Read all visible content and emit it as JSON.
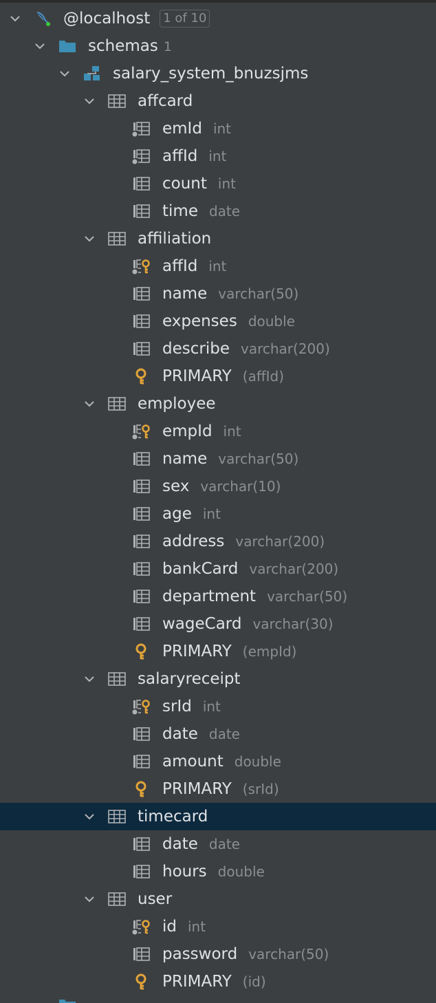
{
  "root": {
    "label": "@localhost",
    "badge": "1 of 10"
  },
  "schemas": {
    "label": "schemas",
    "count": "1"
  },
  "schema": {
    "label": "salary_system_bnuzsjms"
  },
  "tables": [
    {
      "name": "affcard",
      "columns": [
        {
          "name": "emId",
          "type": "int",
          "kind": "fk"
        },
        {
          "name": "affId",
          "type": "int",
          "kind": "fk"
        },
        {
          "name": "count",
          "type": "int",
          "kind": "col"
        },
        {
          "name": "time",
          "type": "date",
          "kind": "col"
        }
      ]
    },
    {
      "name": "affiliation",
      "columns": [
        {
          "name": "affId",
          "type": "int",
          "kind": "pk"
        },
        {
          "name": "name",
          "type": "varchar(50)",
          "kind": "col"
        },
        {
          "name": "expenses",
          "type": "double",
          "kind": "col"
        },
        {
          "name": "describe",
          "type": "varchar(200)",
          "kind": "col"
        },
        {
          "name": "PRIMARY",
          "type": "(affId)",
          "kind": "key"
        }
      ]
    },
    {
      "name": "employee",
      "columns": [
        {
          "name": "empId",
          "type": "int",
          "kind": "pk"
        },
        {
          "name": "name",
          "type": "varchar(50)",
          "kind": "col"
        },
        {
          "name": "sex",
          "type": "varchar(10)",
          "kind": "col"
        },
        {
          "name": "age",
          "type": "int",
          "kind": "col"
        },
        {
          "name": "address",
          "type": "varchar(200)",
          "kind": "col"
        },
        {
          "name": "bankCard",
          "type": "varchar(200)",
          "kind": "col"
        },
        {
          "name": "department",
          "type": "varchar(50)",
          "kind": "col"
        },
        {
          "name": "wageCard",
          "type": "varchar(30)",
          "kind": "col"
        },
        {
          "name": "PRIMARY",
          "type": "(empId)",
          "kind": "key"
        }
      ]
    },
    {
      "name": "salaryreceipt",
      "columns": [
        {
          "name": "srId",
          "type": "int",
          "kind": "pk"
        },
        {
          "name": "date",
          "type": "date",
          "kind": "col"
        },
        {
          "name": "amount",
          "type": "double",
          "kind": "col"
        },
        {
          "name": "PRIMARY",
          "type": "(srId)",
          "kind": "key"
        }
      ]
    },
    {
      "name": "timecard",
      "selected": true,
      "columns": [
        {
          "name": "date",
          "type": "date",
          "kind": "col"
        },
        {
          "name": "hours",
          "type": "double",
          "kind": "col"
        }
      ]
    },
    {
      "name": "user",
      "columns": [
        {
          "name": "id",
          "type": "int",
          "kind": "pk"
        },
        {
          "name": "password",
          "type": "varchar(50)",
          "kind": "col"
        },
        {
          "name": "PRIMARY",
          "type": "(id)",
          "kind": "key"
        }
      ]
    }
  ],
  "colors": {
    "background": "#3c3f41",
    "selection": "#0d293e",
    "text": "#dfe1e5",
    "muted": "#8c8e91",
    "folder": "#3d8fb5",
    "key": "#e2a438"
  },
  "icons": {
    "root": "database-connection-icon",
    "schemas": "folder-icon",
    "schema": "schema-icon",
    "table": "table-icon",
    "column": "column-icon",
    "fk": "foreign-key-column-icon",
    "pk": "primary-key-column-icon",
    "key": "key-icon",
    "chevron": "chevron-down-icon"
  }
}
